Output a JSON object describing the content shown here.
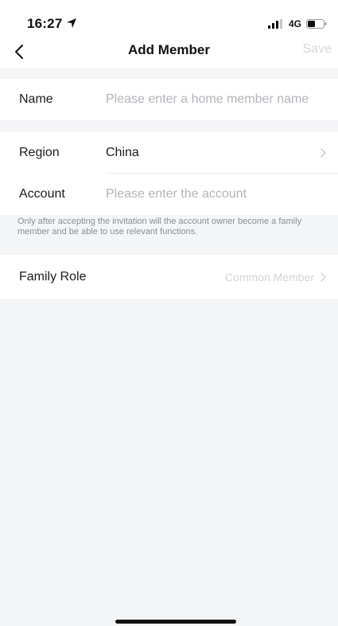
{
  "status_bar": {
    "time": "16:27",
    "network": "4G",
    "icons": [
      "location-arrow-icon",
      "signal-icon",
      "battery-icon"
    ]
  },
  "nav": {
    "title": "Add Member",
    "save_label": "Save",
    "back_icon": "chevron-left-icon"
  },
  "form": {
    "name": {
      "label": "Name",
      "placeholder": "Please enter a home member name",
      "value": ""
    },
    "region": {
      "label": "Region",
      "value": "China"
    },
    "account": {
      "label": "Account",
      "placeholder": "Please enter the account",
      "value": ""
    },
    "notice": "Only after accepting the invitation will the account owner become a family member and be able to use relevant functions.",
    "family_role": {
      "label": "Family Role",
      "value": "Common Member"
    }
  },
  "colors": {
    "background": "#f4f5f7",
    "card": "#ffffff",
    "placeholder": "#b3b5ba",
    "disabled_text": "#d4d6da"
  }
}
